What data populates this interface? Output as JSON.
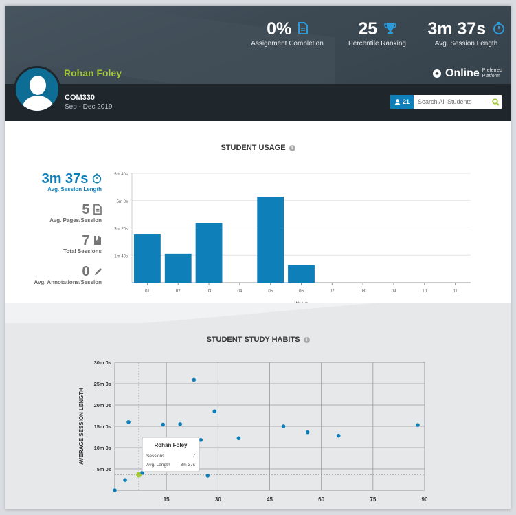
{
  "header": {
    "stats": [
      {
        "value": "0%",
        "label": "Assignment Completion",
        "icon": "document-icon"
      },
      {
        "value": "25",
        "label": "Percentile Ranking",
        "icon": "trophy-icon"
      },
      {
        "value": "3m 37s",
        "label": "Avg. Session Length",
        "icon": "stopwatch-icon"
      }
    ],
    "student_name": "Rohan Foley",
    "course_code": "COM330",
    "term": "Sep - Dec 2019",
    "platform": "Online",
    "platform_label_1": "Preferred",
    "platform_label_2": "Platform",
    "student_count": "21",
    "search_placeholder": "Search All Students"
  },
  "usage": {
    "title": "STUDENT USAGE",
    "metrics": [
      {
        "value": "3m 37s",
        "label": "Avg. Session Length",
        "icon": "stopwatch-icon"
      },
      {
        "value": "5",
        "label": "Avg. Pages/Session",
        "icon": "document-icon"
      },
      {
        "value": "7",
        "label": "Total Sessions",
        "icon": "book-icon"
      },
      {
        "value": "0",
        "label": "Avg. Annotations/Session",
        "icon": "pencil-icon"
      }
    ]
  },
  "habits": {
    "title": "STUDENT STUDY HABITS",
    "tooltip": {
      "name": "Rohan Foley",
      "sessions_label": "Sessions",
      "sessions_value": "7",
      "avg_label": "Avg. Length",
      "avg_value": "3m 37s"
    }
  },
  "colors": {
    "accent": "#0e7fb8",
    "highlight": "#a4c639"
  },
  "chart_data": [
    {
      "type": "bar",
      "title": "",
      "xlabel": "Weeks",
      "ylabel": "",
      "categories": [
        "01",
        "02",
        "03",
        "04",
        "05",
        "06",
        "07",
        "08",
        "09",
        "10",
        "11"
      ],
      "values": [
        176,
        106,
        218,
        0,
        314,
        63,
        0,
        0,
        0,
        0,
        0
      ],
      "ytick_values": [
        100,
        200,
        300
      ],
      "ytick_labels": [
        "1m 40s",
        "3m 20s",
        "5m 0s",
        "6m 40s"
      ],
      "ylim": [
        0,
        400
      ],
      "unit": "seconds",
      "grid": true
    },
    {
      "type": "scatter",
      "title": "",
      "xlabel": "",
      "ylabel": "AVERAGE SESSION LENGTH",
      "xlim": [
        0,
        90
      ],
      "ylim": [
        0,
        30
      ],
      "xticks": [
        15,
        30,
        45,
        60,
        75,
        90
      ],
      "yticks": [
        5,
        10,
        15,
        20,
        25,
        30
      ],
      "ytick_labels": [
        "5m 0s",
        "10m 0s",
        "15m 0s",
        "20m 0s",
        "25m 0s",
        "30m 0s"
      ],
      "points": [
        {
          "x": 0,
          "y": 0
        },
        {
          "x": 3,
          "y": 2.4
        },
        {
          "x": 4,
          "y": 16
        },
        {
          "x": 7,
          "y": 3.6,
          "highlight": true
        },
        {
          "x": 8,
          "y": 4.1
        },
        {
          "x": 14,
          "y": 15.4
        },
        {
          "x": 19,
          "y": 15.5
        },
        {
          "x": 23,
          "y": 25.9
        },
        {
          "x": 25,
          "y": 11.8
        },
        {
          "x": 27,
          "y": 3.4
        },
        {
          "x": 29,
          "y": 18.5
        },
        {
          "x": 36,
          "y": 12.2
        },
        {
          "x": 49,
          "y": 15
        },
        {
          "x": 56,
          "y": 13.6
        },
        {
          "x": 65,
          "y": 12.8
        },
        {
          "x": 88,
          "y": 15.3
        }
      ],
      "grid": true
    }
  ]
}
